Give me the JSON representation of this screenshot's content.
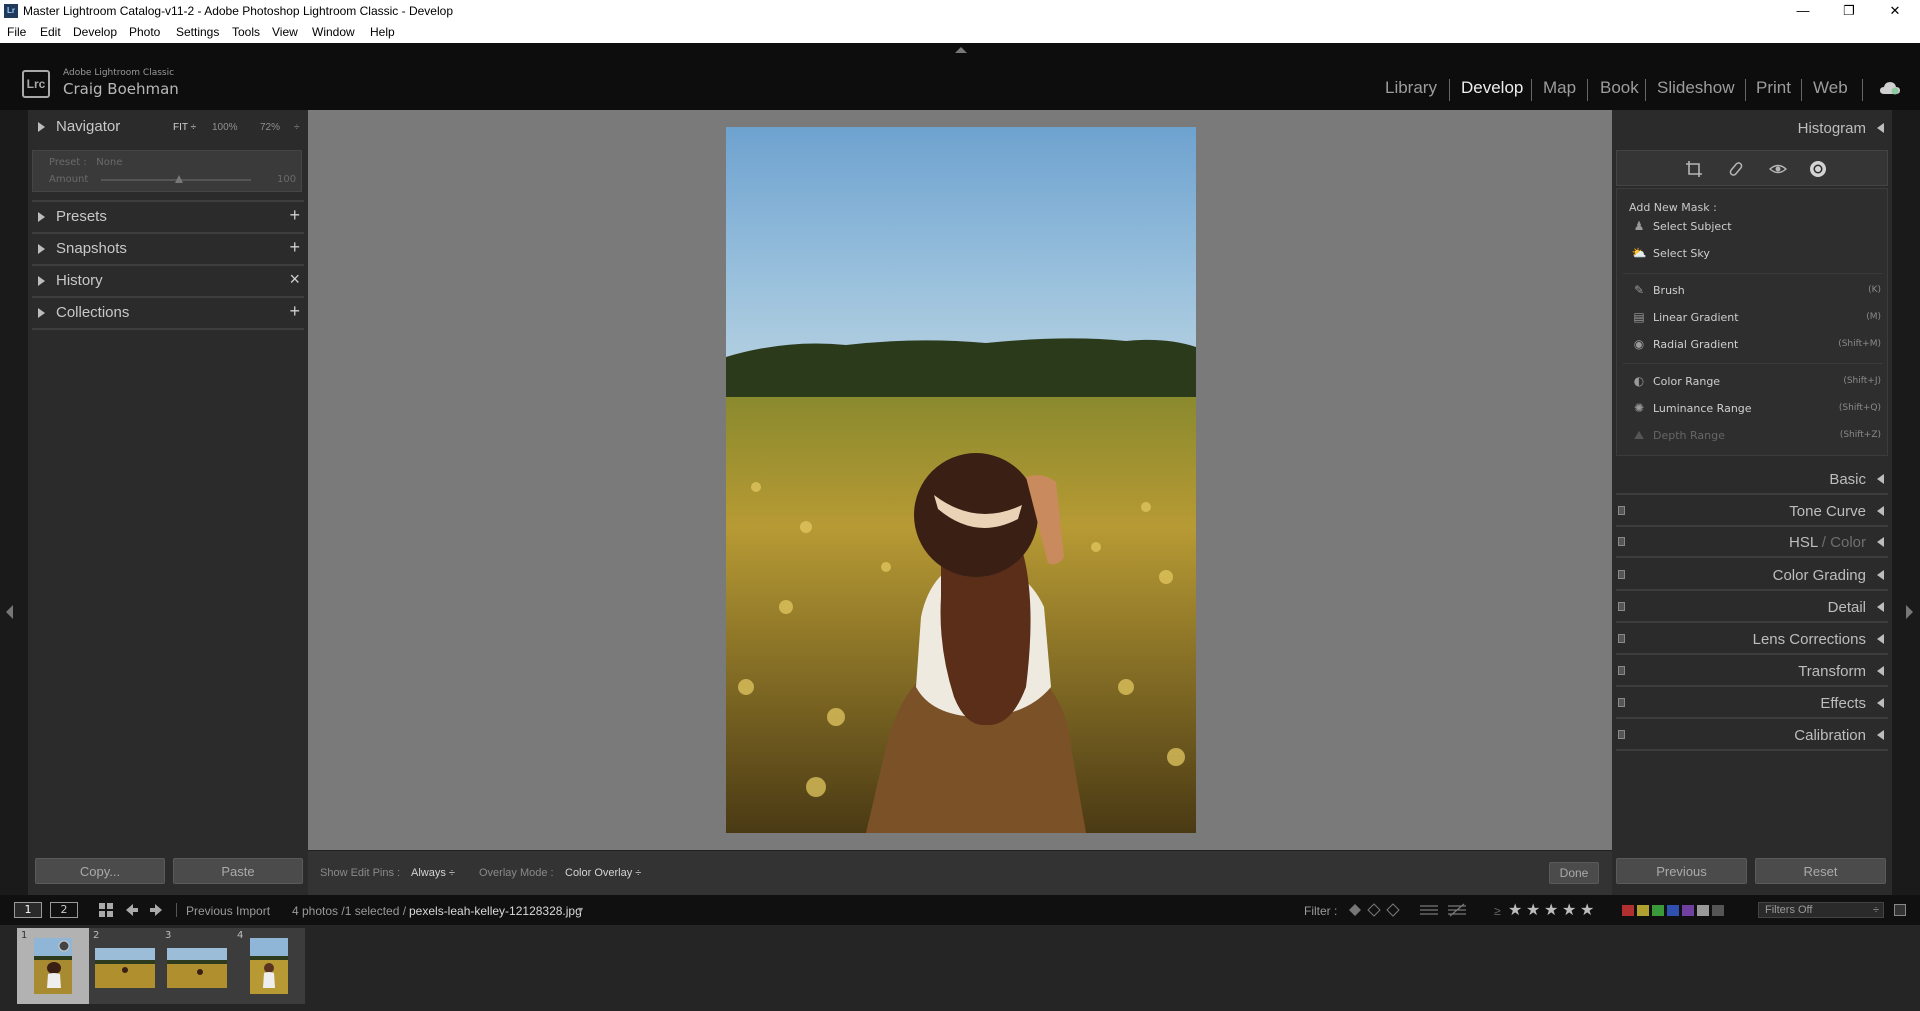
{
  "window": {
    "title": "Master Lightroom Catalog-v11-2 - Adobe Photoshop Lightroom Classic - Develop",
    "controls": [
      "—",
      "❐",
      "✕"
    ]
  },
  "menu": [
    "File",
    "Edit",
    "Develop",
    "Photo",
    "Settings",
    "Tools",
    "View",
    "Window",
    "Help"
  ],
  "identity": {
    "logo": "Lrc",
    "app": "Adobe Lightroom Classic",
    "user": "Craig Boehman"
  },
  "modules": [
    "Library",
    "Develop",
    "Map",
    "Book",
    "Slideshow",
    "Print",
    "Web"
  ],
  "left_panel": {
    "navigator": {
      "label": "Navigator",
      "fit": "FIT ÷",
      "zoom1": "100%",
      "zoom2": "72%",
      "more": "÷"
    },
    "preset_box": {
      "preset_label": "Preset :",
      "preset_value": "None",
      "amount_label": "Amount",
      "amount_value": "100"
    },
    "presets": {
      "label": "Presets",
      "action": "+"
    },
    "snapshots": {
      "label": "Snapshots",
      "action": "+"
    },
    "history": {
      "label": "History",
      "action": "×"
    },
    "collections": {
      "label": "Collections",
      "action": "+"
    },
    "copy_button": "Copy...",
    "paste_button": "Paste"
  },
  "right_panel": {
    "histogram": "Histogram",
    "mask_title": "Add New Mask :",
    "mask_items": [
      {
        "label": "Select Subject",
        "shortcut": ""
      },
      {
        "label": "Select Sky",
        "shortcut": ""
      },
      {
        "label": "Brush",
        "shortcut": "(K)"
      },
      {
        "label": "Linear Gradient",
        "shortcut": "(M)"
      },
      {
        "label": "Radial Gradient",
        "shortcut": "(Shift+M)"
      },
      {
        "label": "Color Range",
        "shortcut": "(Shift+J)"
      },
      {
        "label": "Luminance Range",
        "shortcut": "(Shift+Q)"
      },
      {
        "label": "Depth Range",
        "shortcut": "(Shift+Z)"
      }
    ],
    "panes": [
      "Basic",
      "Tone Curve",
      "HSL / Color",
      "Color Grading",
      "Detail",
      "Lens Corrections",
      "Transform",
      "Effects",
      "Calibration"
    ],
    "hsl_part1": "HSL",
    "hsl_part2": " / Color",
    "previous_button": "Previous",
    "reset_button": "Reset"
  },
  "toolbar": {
    "show_edit_pins_label": "Show Edit Pins :",
    "show_edit_pins_value": "Always ÷",
    "overlay_mode_label": "Overlay Mode :",
    "overlay_mode_value": "Color Overlay ÷",
    "done_button": "Done"
  },
  "filmstrip_bar": {
    "screen1": "1",
    "screen2": "2",
    "source": "Previous Import",
    "count": "4 photos /1 selected /",
    "filename": "pexels-leah-kelley-12128328.jpg",
    "filter_label": "Filter :",
    "filter_value": "Filters Off",
    "label_colors": [
      "#b03030",
      "#b0a030",
      "#3a9a3a",
      "#3050b0",
      "#7040a0",
      "#999999",
      "#555555"
    ]
  },
  "thumbnails": [
    {
      "number": "1",
      "selected": true
    },
    {
      "number": "2",
      "selected": false
    },
    {
      "number": "3",
      "selected": false
    },
    {
      "number": "4",
      "selected": false
    }
  ]
}
